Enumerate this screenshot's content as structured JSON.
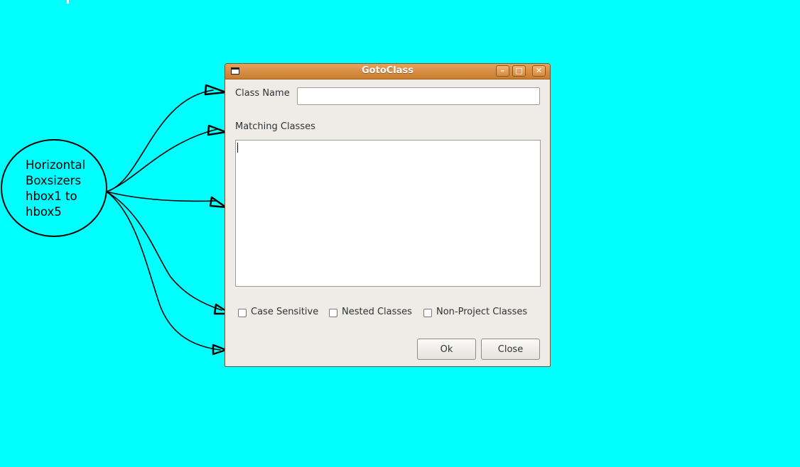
{
  "annotation": {
    "text": "Horizontal\nBoxsizers\nhbox1 to\nhbox5"
  },
  "dialog": {
    "title": "GotoClass",
    "window_buttons": {
      "minimize": "–",
      "maximize": "□",
      "close": "✕"
    },
    "class_name_label": "Class Name",
    "class_name_value": "",
    "matching_label": "Matching Classes",
    "checkboxes": {
      "case_sensitive": {
        "label": "Case Sensitive",
        "checked": false
      },
      "nested_classes": {
        "label": "Nested Classes",
        "checked": false
      },
      "non_project_classes": {
        "label": "Non-Project Classes",
        "checked": false
      }
    },
    "ok_label": "Ok",
    "close_label": "Close"
  },
  "colors": {
    "background": "#00ffff",
    "titlebar": "#d58a3d",
    "dialog_bg": "#efebe7"
  },
  "icons": [
    "window-menu-icon",
    "minimize-icon",
    "maximize-icon",
    "close-icon",
    "arrow-icon"
  ]
}
